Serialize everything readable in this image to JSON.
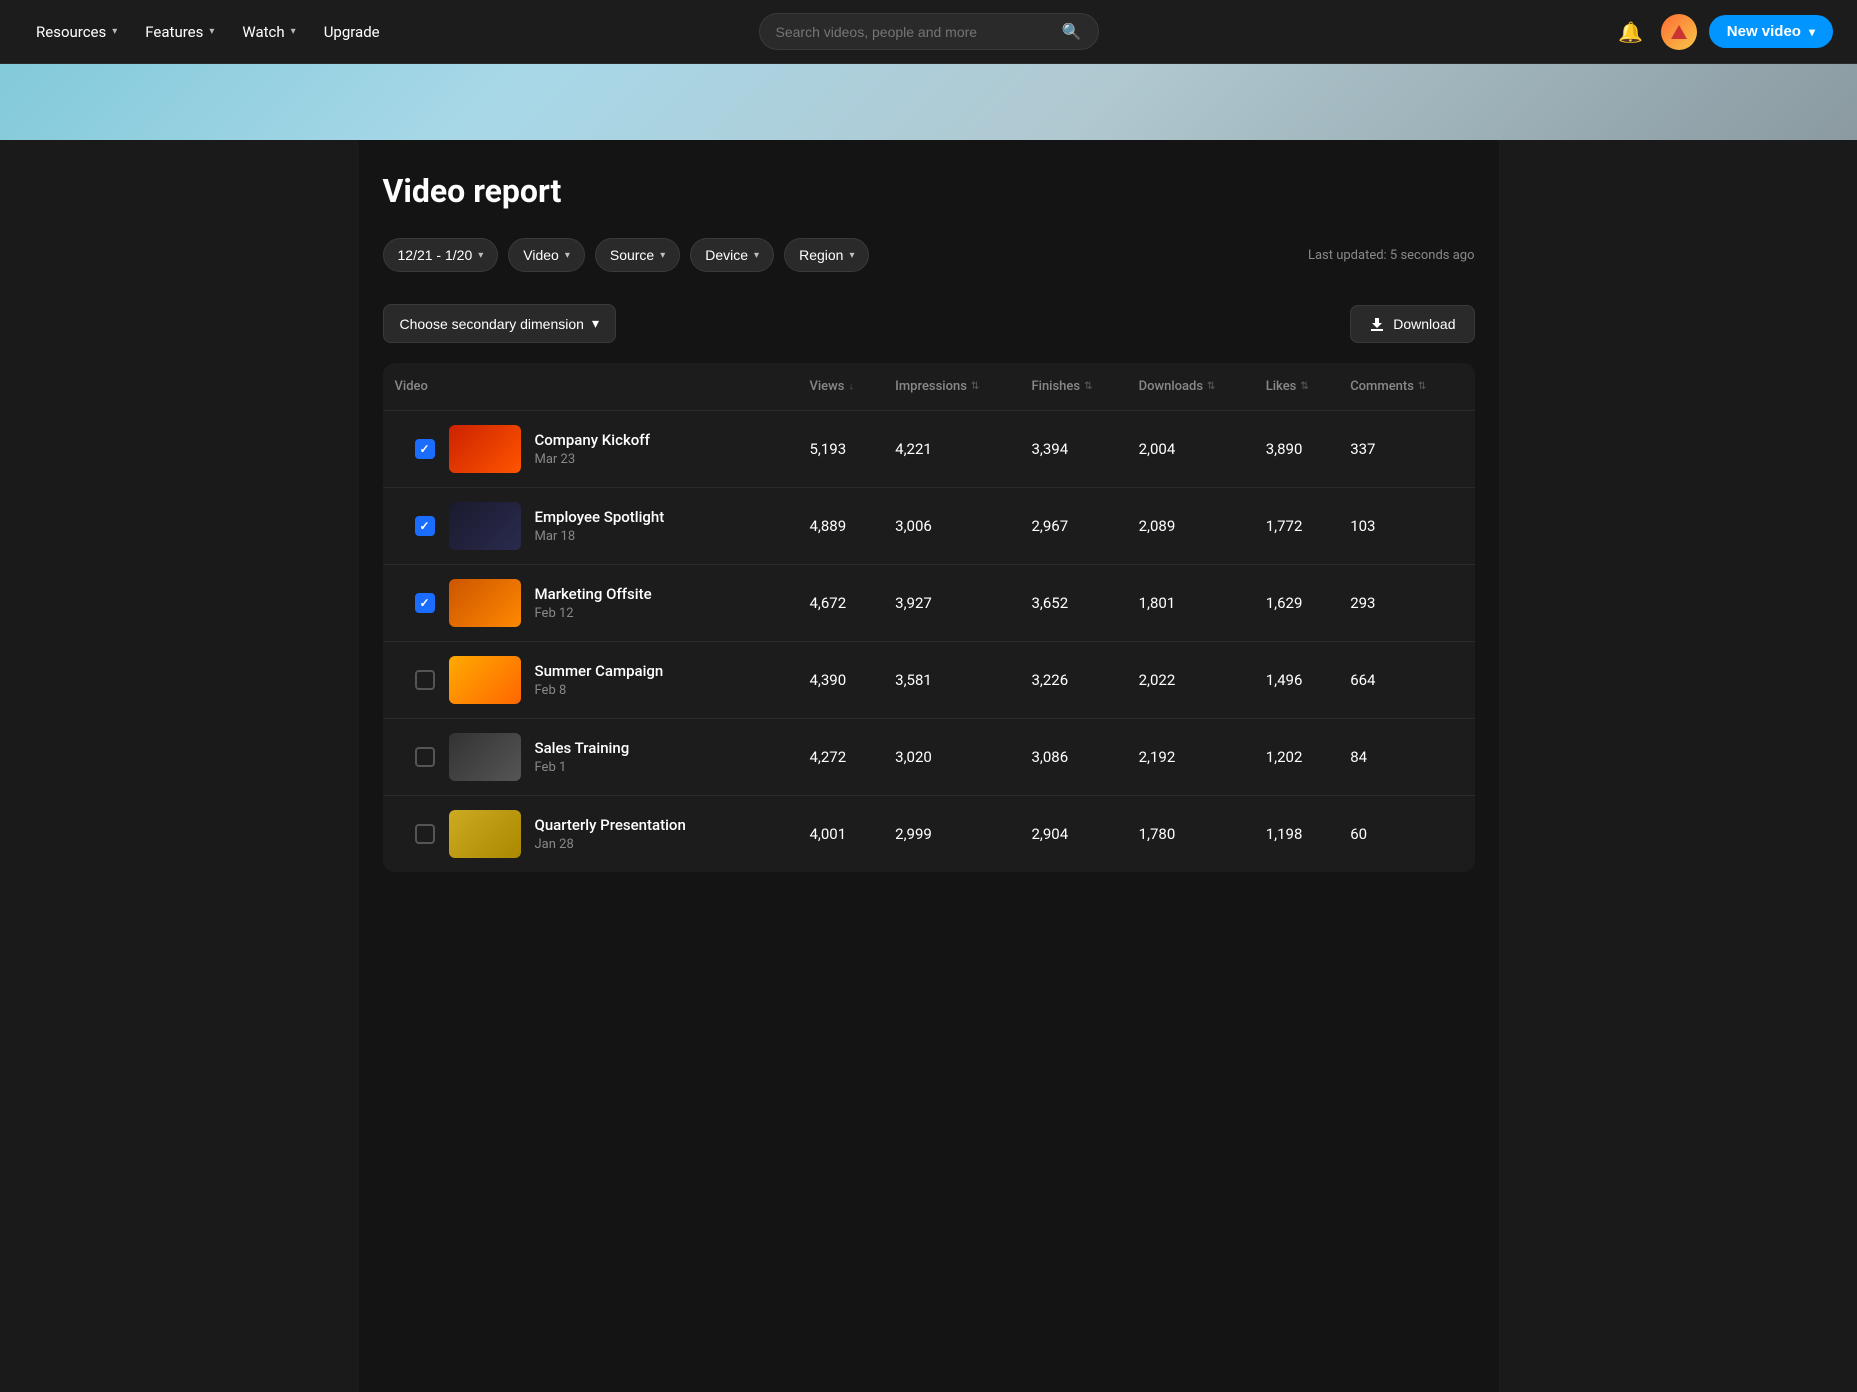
{
  "meta": {
    "title": "Video report",
    "last_updated": "Last updated: 5 seconds ago"
  },
  "navbar": {
    "items": [
      {
        "id": "resources",
        "label": "Resources"
      },
      {
        "id": "features",
        "label": "Features"
      },
      {
        "id": "watch",
        "label": "Watch"
      },
      {
        "id": "upgrade",
        "label": "Upgrade"
      }
    ],
    "search_placeholder": "Search videos, people and more",
    "new_video_label": "New video"
  },
  "filters": [
    {
      "id": "date",
      "label": "12/21 - 1/20"
    },
    {
      "id": "video",
      "label": "Video"
    },
    {
      "id": "source",
      "label": "Source"
    },
    {
      "id": "device",
      "label": "Device"
    },
    {
      "id": "region",
      "label": "Region"
    }
  ],
  "secondary_dimension_label": "Choose secondary dimension",
  "download_label": "Download",
  "table": {
    "columns": [
      {
        "id": "video",
        "label": "Video",
        "sortable": false
      },
      {
        "id": "views",
        "label": "Views",
        "sortable": true,
        "sort_dir": "desc"
      },
      {
        "id": "impressions",
        "label": "Impressions",
        "sortable": true
      },
      {
        "id": "finishes",
        "label": "Finishes",
        "sortable": true
      },
      {
        "id": "downloads",
        "label": "Downloads",
        "sortable": true
      },
      {
        "id": "likes",
        "label": "Likes",
        "sortable": true
      },
      {
        "id": "comments",
        "label": "Comments",
        "sortable": true
      }
    ],
    "rows": [
      {
        "id": 1,
        "checked": true,
        "name": "Company Kickoff",
        "date": "Mar 23",
        "thumb_class": "thumb-kickoff",
        "views": "5,193",
        "impressions": "4,221",
        "finishes": "3,394",
        "downloads": "2,004",
        "likes": "3,890",
        "comments": "337"
      },
      {
        "id": 2,
        "checked": true,
        "name": "Employee Spotlight",
        "date": "Mar 18",
        "thumb_class": "thumb-spotlight",
        "views": "4,889",
        "impressions": "3,006",
        "finishes": "2,967",
        "downloads": "2,089",
        "likes": "1,772",
        "comments": "103"
      },
      {
        "id": 3,
        "checked": true,
        "name": "Marketing Offsite",
        "date": "Feb 12",
        "thumb_class": "thumb-offsite",
        "views": "4,672",
        "impressions": "3,927",
        "finishes": "3,652",
        "downloads": "1,801",
        "likes": "1,629",
        "comments": "293"
      },
      {
        "id": 4,
        "checked": false,
        "name": "Summer Campaign",
        "date": "Feb 8",
        "thumb_class": "thumb-summer",
        "views": "4,390",
        "impressions": "3,581",
        "finishes": "3,226",
        "downloads": "2,022",
        "likes": "1,496",
        "comments": "664"
      },
      {
        "id": 5,
        "checked": false,
        "name": "Sales Training",
        "date": "Feb 1",
        "thumb_class": "thumb-training",
        "views": "4,272",
        "impressions": "3,020",
        "finishes": "3,086",
        "downloads": "2,192",
        "likes": "1,202",
        "comments": "84"
      },
      {
        "id": 6,
        "checked": false,
        "name": "Quarterly Presentation",
        "date": "Jan 28",
        "thumb_class": "thumb-quarterly",
        "views": "4,001",
        "impressions": "2,999",
        "finishes": "2,904",
        "downloads": "1,780",
        "likes": "1,198",
        "comments": "60"
      }
    ]
  }
}
